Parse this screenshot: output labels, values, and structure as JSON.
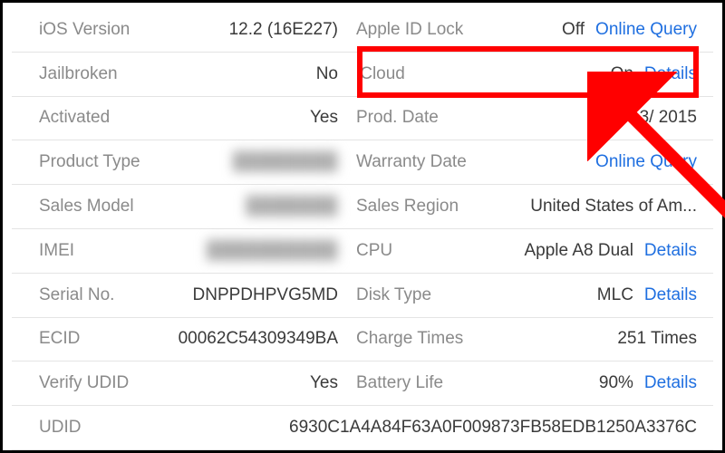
{
  "left": {
    "ios_version": {
      "label": "iOS Version",
      "value": "12.2 (16E227)"
    },
    "jailbroken": {
      "label": "Jailbroken",
      "value": "No"
    },
    "activated": {
      "label": "Activated",
      "value": "Yes"
    },
    "product_type": {
      "label": "Product Type",
      "value": "████████"
    },
    "sales_model": {
      "label": "Sales Model",
      "value": "███████"
    },
    "imei": {
      "label": "IMEI",
      "value": "██████████"
    },
    "serial_no": {
      "label": "Serial No.",
      "value": "DNPPDHPVG5MD"
    },
    "ecid": {
      "label": "ECID",
      "value": "00062C54309349BA"
    },
    "verify_udid": {
      "label": "Verify UDID",
      "value": "Yes"
    }
  },
  "right": {
    "apple_id_lock": {
      "label": "Apple ID Lock",
      "value": "Off",
      "link": "Online Query"
    },
    "icloud": {
      "label": "iCloud",
      "value": "On",
      "link": "Details"
    },
    "prod_date": {
      "label": "Prod. Date",
      "value": "3/    2015"
    },
    "warranty_date": {
      "label": "Warranty Date",
      "link": "Online Query"
    },
    "sales_region": {
      "label": "Sales Region",
      "value": "United States of Am..."
    },
    "cpu": {
      "label": "CPU",
      "value": "Apple A8 Dual",
      "link": "Details"
    },
    "disk_type": {
      "label": "Disk Type",
      "value": "MLC",
      "link": "Details"
    },
    "charge_times": {
      "label": "Charge Times",
      "value": "251 Times"
    },
    "battery_life": {
      "label": "Battery Life",
      "value": "90%",
      "link": "Details"
    }
  },
  "udid": {
    "label": "UDID",
    "value": "6930C1A4A84F63A0F009873FB58EDB1250A3376C"
  }
}
